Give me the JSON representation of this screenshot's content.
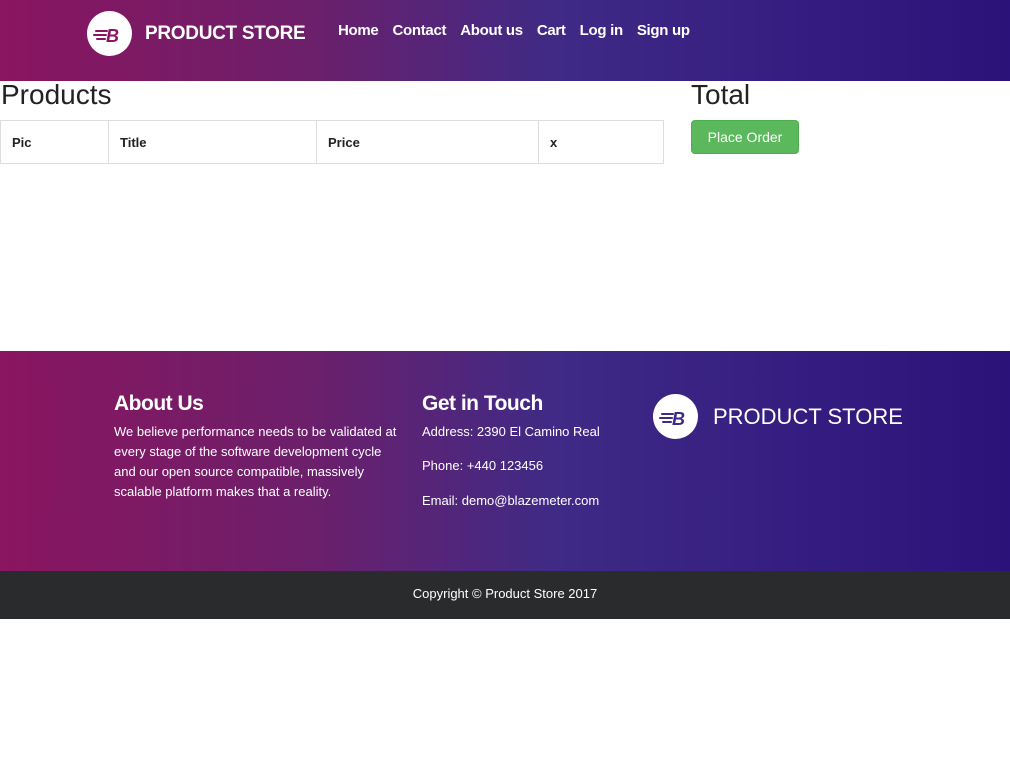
{
  "navbar": {
    "brand": "PRODUCT STORE",
    "logo_icon": "blazemeter-logo-icon",
    "links": [
      "Home",
      "Contact",
      "About us",
      "Cart",
      "Log in",
      "Sign up"
    ]
  },
  "products": {
    "title": "Products",
    "columns": [
      "Pic",
      "Title",
      "Price",
      "x"
    ]
  },
  "total": {
    "title": "Total",
    "place_order_label": "Place Order"
  },
  "footer": {
    "about": {
      "title": "About Us",
      "text": "We believe performance needs to be validated at every stage of the software development cycle and our open source compatible, massively scalable platform makes that a reality."
    },
    "contact": {
      "title": "Get in Touch",
      "address": "Address: 2390 El Camino Real",
      "phone": "Phone: +440 123456",
      "email": "Email: demo@blazemeter.com"
    },
    "brand": "PRODUCT STORE",
    "copyright": "Copyright © Product Store 2017"
  },
  "colors": {
    "gradient_start": "#8a1560",
    "gradient_end": "#2b127a",
    "success": "#5cb85c",
    "copyright_bg": "#292b2c"
  }
}
